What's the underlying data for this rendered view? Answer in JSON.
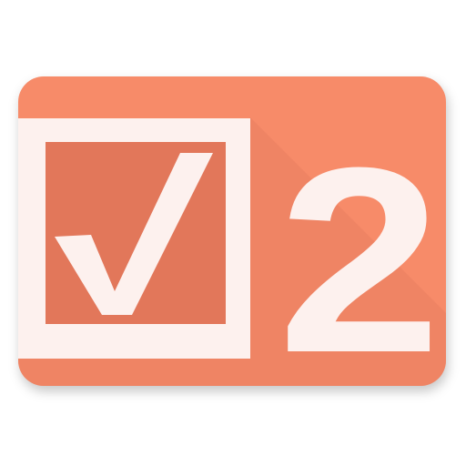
{
  "icon": {
    "semantic": "checklist-two-icon",
    "badge_text": "2",
    "colors": {
      "background": "#F78B69",
      "shadow_tint": "#E2775A",
      "foreground": "#FDF1EE"
    }
  }
}
